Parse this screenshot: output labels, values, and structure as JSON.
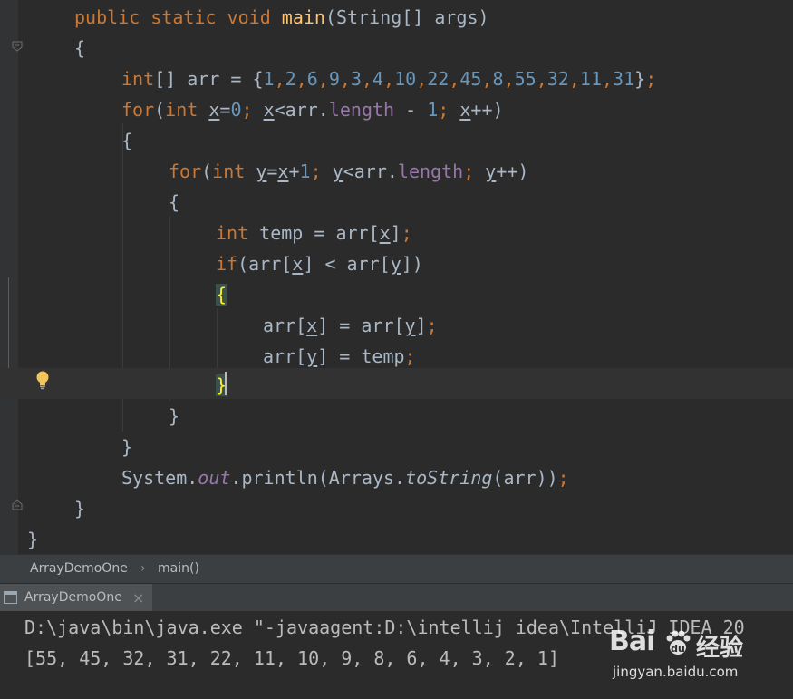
{
  "editor": {
    "lines": [
      {
        "segments": [
          {
            "text": "public static void ",
            "cls": "kw"
          },
          {
            "text": "main",
            "cls": "fn"
          },
          {
            "text": "(String[] args)"
          }
        ]
      },
      {
        "segments": [
          {
            "text": "{"
          }
        ]
      },
      {
        "segments": [
          {
            "text": "int",
            "cls": "kw"
          },
          {
            "text": "[] arr = {"
          },
          {
            "text": "1",
            "cls": "num"
          },
          {
            "text": ",",
            "cls": "kw"
          },
          {
            "text": "2",
            "cls": "num"
          },
          {
            "text": ",",
            "cls": "kw"
          },
          {
            "text": "6",
            "cls": "num"
          },
          {
            "text": ",",
            "cls": "kw"
          },
          {
            "text": "9",
            "cls": "num"
          },
          {
            "text": ",",
            "cls": "kw"
          },
          {
            "text": "3",
            "cls": "num"
          },
          {
            "text": ",",
            "cls": "kw"
          },
          {
            "text": "4",
            "cls": "num"
          },
          {
            "text": ",",
            "cls": "kw"
          },
          {
            "text": "10",
            "cls": "num"
          },
          {
            "text": ",",
            "cls": "kw"
          },
          {
            "text": "22",
            "cls": "num"
          },
          {
            "text": ",",
            "cls": "kw"
          },
          {
            "text": "45",
            "cls": "num"
          },
          {
            "text": ",",
            "cls": "kw"
          },
          {
            "text": "8",
            "cls": "num"
          },
          {
            "text": ",",
            "cls": "kw"
          },
          {
            "text": "55",
            "cls": "num"
          },
          {
            "text": ",",
            "cls": "kw"
          },
          {
            "text": "32",
            "cls": "num"
          },
          {
            "text": ",",
            "cls": "kw"
          },
          {
            "text": "11",
            "cls": "num"
          },
          {
            "text": ",",
            "cls": "kw"
          },
          {
            "text": "31",
            "cls": "num"
          },
          {
            "text": "}"
          },
          {
            "text": ";",
            "cls": "kw"
          }
        ]
      },
      {
        "segments": [
          {
            "text": "for",
            "cls": "kw"
          },
          {
            "text": "("
          },
          {
            "text": "int ",
            "cls": "kw"
          },
          {
            "text": "x",
            "cls": "u"
          },
          {
            "text": "="
          },
          {
            "text": "0",
            "cls": "num"
          },
          {
            "text": "; ",
            "cls": "kw"
          },
          {
            "text": "x",
            "cls": "u"
          },
          {
            "text": "<arr."
          },
          {
            "text": "length",
            "cls": "fld"
          },
          {
            "text": " - "
          },
          {
            "text": "1",
            "cls": "num"
          },
          {
            "text": "; ",
            "cls": "kw"
          },
          {
            "text": "x",
            "cls": "u"
          },
          {
            "text": "++)"
          }
        ]
      },
      {
        "segments": [
          {
            "text": "{"
          }
        ]
      },
      {
        "segments": [
          {
            "text": "for",
            "cls": "kw"
          },
          {
            "text": "("
          },
          {
            "text": "int ",
            "cls": "kw"
          },
          {
            "text": "y",
            "cls": "u"
          },
          {
            "text": "="
          },
          {
            "text": "x",
            "cls": "u"
          },
          {
            "text": "+"
          },
          {
            "text": "1",
            "cls": "num"
          },
          {
            "text": "; ",
            "cls": "kw"
          },
          {
            "text": "y",
            "cls": "u"
          },
          {
            "text": "<arr."
          },
          {
            "text": "length",
            "cls": "fld"
          },
          {
            "text": "; ",
            "cls": "kw"
          },
          {
            "text": "y",
            "cls": "u"
          },
          {
            "text": "++)"
          }
        ]
      },
      {
        "segments": [
          {
            "text": "{"
          }
        ]
      },
      {
        "segments": [
          {
            "text": "int ",
            "cls": "kw"
          },
          {
            "text": "temp = arr["
          },
          {
            "text": "x",
            "cls": "u"
          },
          {
            "text": "]"
          },
          {
            "text": ";",
            "cls": "kw"
          }
        ]
      },
      {
        "segments": [
          {
            "text": "if",
            "cls": "kw"
          },
          {
            "text": "(arr["
          },
          {
            "text": "x",
            "cls": "u"
          },
          {
            "text": "] < arr["
          },
          {
            "text": "y",
            "cls": "u"
          },
          {
            "text": "])"
          }
        ]
      },
      {
        "segments": [
          {
            "text": "{",
            "cls": "match"
          }
        ]
      },
      {
        "segments": [
          {
            "text": "arr["
          },
          {
            "text": "x",
            "cls": "u"
          },
          {
            "text": "] = arr["
          },
          {
            "text": "y",
            "cls": "u"
          },
          {
            "text": "]"
          },
          {
            "text": ";",
            "cls": "kw"
          }
        ]
      },
      {
        "segments": [
          {
            "text": "arr["
          },
          {
            "text": "y",
            "cls": "u"
          },
          {
            "text": "] = temp"
          },
          {
            "text": ";",
            "cls": "kw"
          }
        ]
      },
      {
        "segments": [
          {
            "text": "}",
            "cls": "match"
          }
        ]
      },
      {
        "segments": [
          {
            "text": "}"
          }
        ]
      },
      {
        "segments": [
          {
            "text": "}"
          }
        ]
      },
      {
        "segments": [
          {
            "text": "System."
          },
          {
            "text": "out",
            "cls": "fld-i"
          },
          {
            "text": ".println(Arrays."
          },
          {
            "text": "toString",
            "cls": "it"
          },
          {
            "text": "(arr))"
          },
          {
            "text": ";",
            "cls": "kw"
          }
        ]
      },
      {
        "segments": [
          {
            "text": "}"
          }
        ]
      },
      {
        "segments": [
          {
            "text": "}"
          }
        ]
      }
    ]
  },
  "breadcrumb": {
    "class_name": "ArrayDemoOne",
    "separator": "›",
    "method_name": "main()"
  },
  "run_panel": {
    "tab_label": "ArrayDemoOne",
    "close_glyph": "×",
    "console_lines": [
      "D:\\java\\bin\\java.exe \"-javaagent:D:\\intellij idea\\IntelliJ IDEA 20",
      "[55, 45, 32, 31, 22, 11, 10, 9, 8, 6, 4, 3, 2, 1]"
    ]
  },
  "watermark": {
    "brand": "Bai",
    "brand_cn": "经验",
    "url": "jingyan.baidu.com"
  },
  "icons": {
    "bulb": "lightbulb-icon",
    "fold": "fold-marker-icon",
    "console": "console-icon"
  }
}
